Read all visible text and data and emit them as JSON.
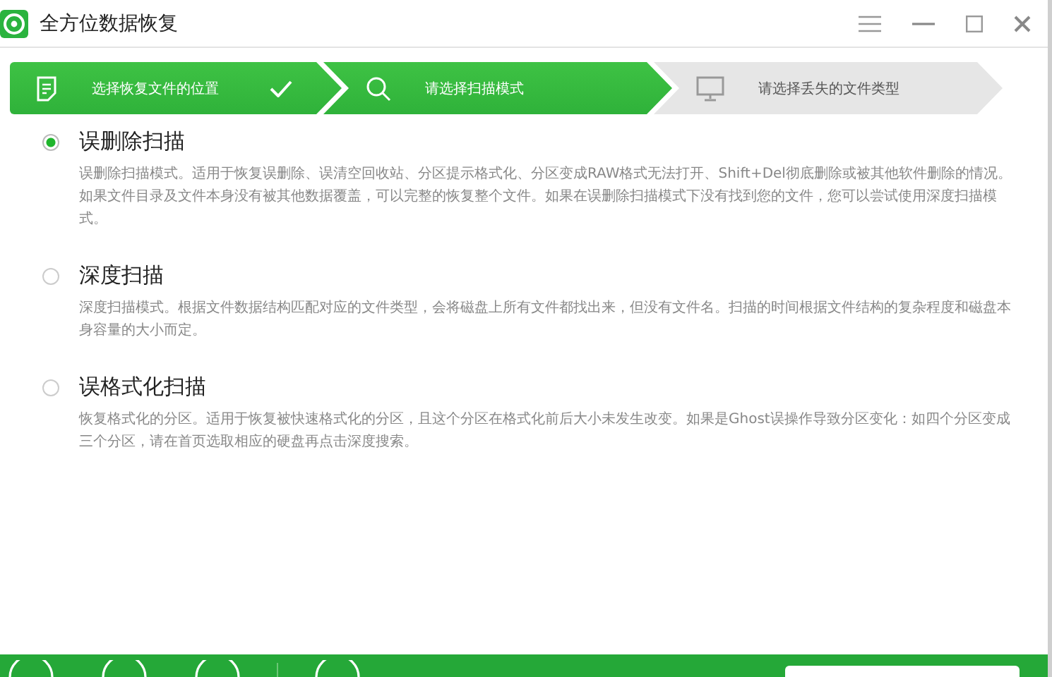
{
  "window": {
    "title": "全方位数据恢复"
  },
  "steps": [
    {
      "label": "选择恢复文件的位置",
      "reached": true,
      "completed": true
    },
    {
      "label": "请选择扫描模式",
      "reached": true,
      "completed": false
    },
    {
      "label": "请选择丢失的文件类型",
      "reached": false,
      "completed": false
    }
  ],
  "scan_modes": [
    {
      "title": "误删除扫描",
      "selected": true,
      "description": "误删除扫描模式。适用于恢复误删除、误清空回收站、分区提示格式化、分区变成RAW格式无法打开、Shift+Del彻底删除或被其他软件删除的情况。如果文件目录及文件本身没有被其他数据覆盖，可以完整的恢复整个文件。如果在误删除扫描模式下没有找到您的文件，您可以尝试使用深度扫描模式。"
    },
    {
      "title": "深度扫描",
      "selected": false,
      "description": "深度扫描模式。根据文件数据结构匹配对应的文件类型，会将磁盘上所有文件都找出来，但没有文件名。扫描的时间根据文件结构的复杂程度和磁盘本身容量的大小而定。"
    },
    {
      "title": "误格式化扫描",
      "selected": false,
      "description": "恢复格式化的分区。适用于恢复被快速格式化的分区，且这个分区在格式化前后大小未发生改变。如果是Ghost误操作导致分区变化：如四个分区变成三个分区，请在首页选取相应的硬盘再点击深度搜索。"
    }
  ]
}
